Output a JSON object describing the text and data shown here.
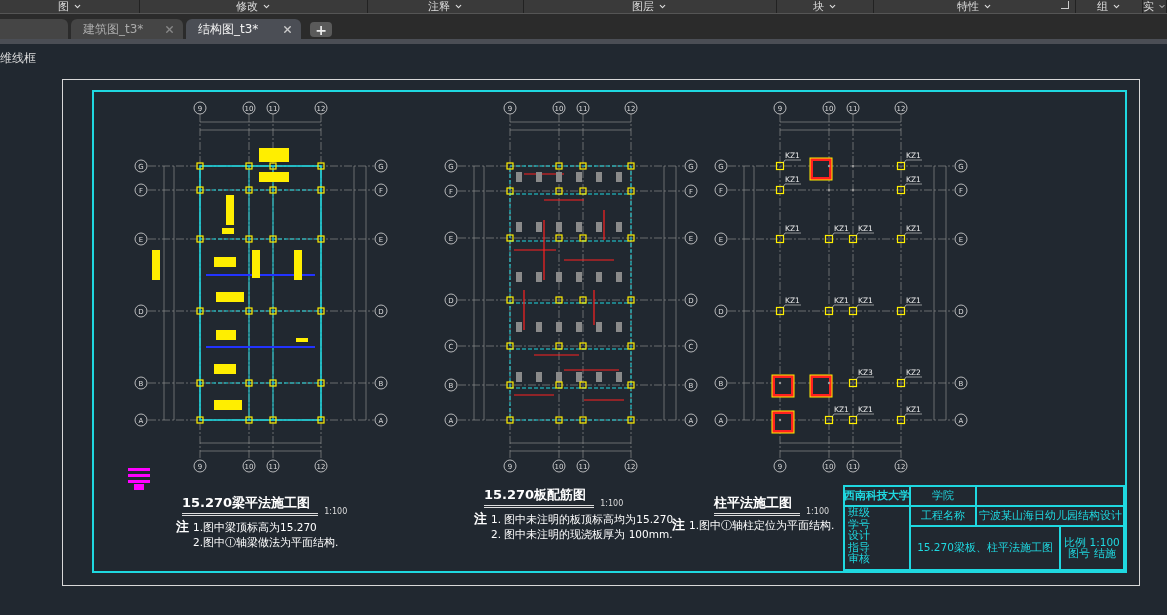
{
  "ribbon": {
    "panels": [
      {
        "label": "图"
      },
      {
        "label": "修改"
      },
      {
        "label": "注释"
      },
      {
        "label": "图层"
      },
      {
        "label": "块"
      },
      {
        "label": "特性",
        "launcher": true
      },
      {
        "label": "组"
      },
      {
        "label": "实"
      }
    ]
  },
  "tabs": [
    {
      "label": "建筑图_t3*",
      "selected": false
    },
    {
      "label": "结构图_t3*",
      "selected": true
    }
  ],
  "new_tab": "+",
  "viewport_label": "维线框",
  "plans": [
    {
      "kind": "beam",
      "top_axes": [
        "9",
        "10",
        "11",
        "12"
      ],
      "bottom_axes": [
        "9",
        "10",
        "11",
        "12"
      ],
      "left_axes": [
        "G",
        "F",
        "E",
        "D",
        "B",
        "A"
      ],
      "right_axes": [
        "G",
        "F",
        "E",
        "D",
        "B",
        "A"
      ],
      "title": "15.270梁平法施工图",
      "scale": "1:100",
      "note_marker": "注",
      "notes": [
        "1.图中梁顶标高为15.270",
        "2.图中Ⓘ轴梁做法为平面结构."
      ]
    },
    {
      "kind": "slab",
      "top_axes": [
        "9",
        "10",
        "11",
        "12"
      ],
      "bottom_axes": [
        "9",
        "10",
        "11",
        "12"
      ],
      "left_axes": [
        "G",
        "F",
        "E",
        "D",
        "C",
        "B",
        "A"
      ],
      "right_axes": [
        "G",
        "F",
        "E",
        "D",
        "C",
        "B",
        "A"
      ],
      "title": "15.270板配筋图",
      "scale": "1:100",
      "note_marker": "注",
      "notes": [
        "1. 图中未注明的板顶标高均为15.270",
        "2. 图中未注明的现浇板厚为 100mm."
      ]
    },
    {
      "kind": "column",
      "top_axes": [
        "9",
        "10",
        "11",
        "12"
      ],
      "bottom_axes": [
        "9",
        "10",
        "11",
        "12"
      ],
      "left_axes": [
        "G",
        "F",
        "E",
        "D",
        "B",
        "A"
      ],
      "right_axes": [
        "G",
        "F",
        "E",
        "D",
        "B",
        "A"
      ],
      "tags_by_row": [
        [
          {
            "tagged": true,
            "label": "KZ1"
          },
          {
            "tagged": false
          },
          {
            "tagged": false
          },
          {
            "tagged": true,
            "label": "KZ1"
          }
        ],
        [
          {
            "tagged": true,
            "label": "KZ1"
          },
          {
            "tagged": false
          },
          {
            "tagged": false
          },
          {
            "tagged": true,
            "label": "KZ1"
          }
        ],
        [
          {
            "tagged": true,
            "label": "KZ1"
          },
          {
            "tagged": true,
            "label": "KZ1"
          },
          {
            "tagged": true,
            "label": "KZ1"
          },
          {
            "tagged": true,
            "label": "KZ1"
          }
        ],
        [
          {
            "tagged": true,
            "label": "KZ1"
          },
          {
            "tagged": true,
            "label": "KZ1"
          },
          {
            "tagged": true,
            "label": "KZ1"
          },
          {
            "tagged": true,
            "label": "KZ1"
          }
        ],
        [
          {
            "tagged": false
          },
          {
            "tagged": false
          },
          {
            "tagged": true,
            "label": "KZ3"
          },
          {
            "tagged": true,
            "label": "KZ2"
          }
        ],
        [
          {
            "tagged": false
          },
          {
            "tagged": true,
            "label": "KZ1"
          },
          {
            "tagged": true,
            "label": "KZ1"
          },
          {
            "tagged": true,
            "label": "KZ1"
          }
        ]
      ],
      "title": "柱平法施工图",
      "scale": "1:100",
      "note_marker": "注",
      "notes": [
        "1.图中Ⓘ轴柱定位为平面结构."
      ]
    }
  ],
  "title_block": {
    "school": "西南科技大学",
    "dept_label": "学院",
    "project_label": "工程名称",
    "project": "宁波某山海日幼儿园结构设计",
    "drawing": "15.270梁板、柱平法施工图",
    "left_labels": [
      "班级",
      "学号",
      "设计",
      "指导",
      "审核"
    ],
    "scale_label": "比例",
    "scale": "1:100",
    "sheet_label": "图号",
    "sheet": "结施"
  }
}
